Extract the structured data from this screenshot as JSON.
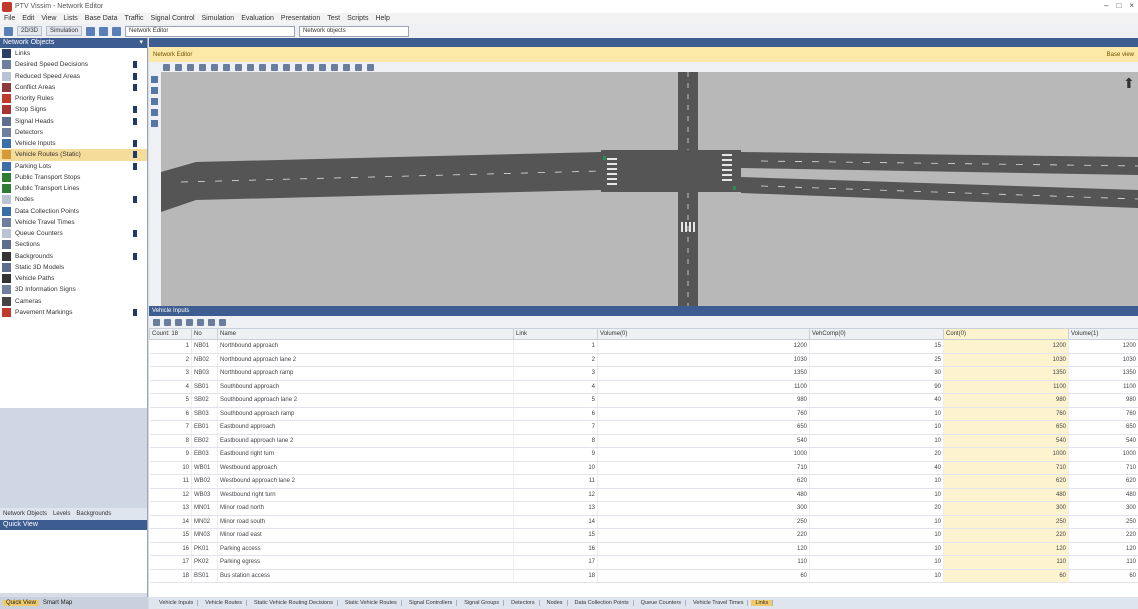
{
  "window": {
    "title": "PTV Vissim - Network Editor",
    "controls": [
      "–",
      "□",
      "×"
    ]
  },
  "menu": {
    "items": [
      "File",
      "Edit",
      "View",
      "Lists",
      "Base Data",
      "Traffic",
      "Signal Control",
      "Simulation",
      "Evaluation",
      "Presentation",
      "Test",
      "Scripts",
      "Help"
    ]
  },
  "toolbar": {
    "buttons": [
      "2D/3D",
      "Simulation"
    ],
    "combo_primary": "Network Editor",
    "combo_secondary": "Network objects"
  },
  "left_panel": {
    "title": "Network Objects",
    "items": [
      {
        "label": "Links",
        "color": "#2b3f66",
        "checked": false
      },
      {
        "label": "Desired Speed Decisions",
        "color": "#6f7f9f",
        "checked": true
      },
      {
        "label": "Reduced Speed Areas",
        "color": "#b9c3d4",
        "checked": true
      },
      {
        "label": "Conflict Areas",
        "color": "#8f3a3a",
        "checked": true
      },
      {
        "label": "Priority Rules",
        "color": "#c0392b",
        "checked": false
      },
      {
        "label": "Stop Signs",
        "color": "#a33",
        "checked": true
      },
      {
        "label": "Signal Heads",
        "color": "#5d6e8f",
        "checked": true
      },
      {
        "label": "Detectors",
        "color": "#6f7f9f",
        "checked": false
      },
      {
        "label": "Vehicle Inputs",
        "color": "#3c6ea8",
        "checked": true
      },
      {
        "label": "Vehicle Routes (Static)",
        "color": "#d49a3a",
        "checked": true
      },
      {
        "label": "Parking Lots",
        "color": "#3c6ea8",
        "checked": true
      },
      {
        "label": "Public Transport Stops",
        "color": "#2e7d32",
        "checked": false
      },
      {
        "label": "Public Transport Lines",
        "color": "#2e7d32",
        "checked": false
      },
      {
        "label": "Nodes",
        "color": "#b9c3d4",
        "checked": true
      },
      {
        "label": "Data Collection Points",
        "color": "#3c6ea8",
        "checked": false
      },
      {
        "label": "Vehicle Travel Times",
        "color": "#6f7f9f",
        "checked": false
      },
      {
        "label": "Queue Counters",
        "color": "#b9c3d4",
        "checked": true
      },
      {
        "label": "Sections",
        "color": "#5d6e8f",
        "checked": false
      },
      {
        "label": "Backgrounds",
        "color": "#333",
        "checked": true
      },
      {
        "label": "Static 3D Models",
        "color": "#5d6e8f",
        "checked": false
      },
      {
        "label": "Vehicle Paths",
        "color": "#333",
        "checked": false
      },
      {
        "label": "3D Information Signs",
        "color": "#6f7f9f",
        "checked": false
      },
      {
        "label": "Cameras",
        "color": "#444",
        "checked": false
      },
      {
        "label": "Pavement Markings",
        "color": "#c0392b",
        "checked": true
      }
    ],
    "selected_index": 9,
    "tabs": [
      "Network Objects",
      "Levels",
      "Backgrounds"
    ],
    "attr_title": "Quick View"
  },
  "bottom_left_tabs": [
    "Quick View",
    "Smart Map"
  ],
  "network": {
    "yellow_bar_left": "Network Editor",
    "yellow_bar_right": "Base view"
  },
  "data_panel": {
    "title": "Vehicle Inputs",
    "columns": [
      "Count: 18",
      "No",
      "Name",
      "Link",
      "Volume(0)",
      "VehComp(0)",
      "Cont(0)",
      "Volume(1)"
    ],
    "rows": [
      {
        "no": "1",
        "code": "NB01",
        "name": "Northbound approach",
        "link": "1",
        "v0": "1200",
        "comp": "15",
        "cont": "1200"
      },
      {
        "no": "2",
        "code": "NB02",
        "name": "Northbound approach lane 2",
        "link": "2",
        "v0": "1030",
        "comp": "25",
        "cont": "1030"
      },
      {
        "no": "3",
        "code": "NB03",
        "name": "Northbound approach ramp",
        "link": "3",
        "v0": "1350",
        "comp": "30",
        "cont": "1350"
      },
      {
        "no": "4",
        "code": "SB01",
        "name": "Southbound approach",
        "link": "4",
        "v0": "1100",
        "comp": "90",
        "cont": "1100"
      },
      {
        "no": "5",
        "code": "SB02",
        "name": "Southbound approach lane 2",
        "link": "5",
        "v0": "980",
        "comp": "40",
        "cont": "980"
      },
      {
        "no": "6",
        "code": "SB03",
        "name": "Southbound approach ramp",
        "link": "6",
        "v0": "760",
        "comp": "10",
        "cont": "760"
      },
      {
        "no": "7",
        "code": "EB01",
        "name": "Eastbound approach",
        "link": "7",
        "v0": "650",
        "comp": "10",
        "cont": "650"
      },
      {
        "no": "8",
        "code": "EB02",
        "name": "Eastbound approach lane 2",
        "link": "8",
        "v0": "540",
        "comp": "10",
        "cont": "540"
      },
      {
        "no": "9",
        "code": "EB03",
        "name": "Eastbound right turn",
        "link": "9",
        "v0": "1000",
        "comp": "20",
        "cont": "1000"
      },
      {
        "no": "10",
        "code": "WB01",
        "name": "Westbound approach",
        "link": "10",
        "v0": "710",
        "comp": "40",
        "cont": "710"
      },
      {
        "no": "11",
        "code": "WB02",
        "name": "Westbound approach lane 2",
        "link": "11",
        "v0": "620",
        "comp": "10",
        "cont": "620"
      },
      {
        "no": "12",
        "code": "WB03",
        "name": "Westbound right turn",
        "link": "12",
        "v0": "480",
        "comp": "10",
        "cont": "480"
      },
      {
        "no": "13",
        "code": "MN01",
        "name": "Minor road north",
        "link": "13",
        "v0": "300",
        "comp": "20",
        "cont": "300"
      },
      {
        "no": "14",
        "code": "MN02",
        "name": "Minor road south",
        "link": "14",
        "v0": "250",
        "comp": "10",
        "cont": "250"
      },
      {
        "no": "15",
        "code": "MN03",
        "name": "Minor road east",
        "link": "15",
        "v0": "220",
        "comp": "10",
        "cont": "220"
      },
      {
        "no": "16",
        "code": "PK01",
        "name": "Parking access",
        "link": "16",
        "v0": "120",
        "comp": "10",
        "cont": "120"
      },
      {
        "no": "17",
        "code": "PK02",
        "name": "Parking egress",
        "link": "17",
        "v0": "110",
        "comp": "10",
        "cont": "110"
      },
      {
        "no": "18",
        "code": "BS01",
        "name": "Bus station access",
        "link": "18",
        "v0": "60",
        "comp": "10",
        "cont": "60"
      }
    ],
    "tabs": [
      "Vehicle Inputs",
      "Vehicle Routes",
      "Static Vehicle Routing Decisions",
      "Static Vehicle Routes",
      "Signal Controllers",
      "Signal Groups",
      "Detectors",
      "Nodes",
      "Data Collection Points",
      "Queue Counters",
      "Vehicle Travel Times",
      "Links"
    ],
    "active_tab": 11
  }
}
